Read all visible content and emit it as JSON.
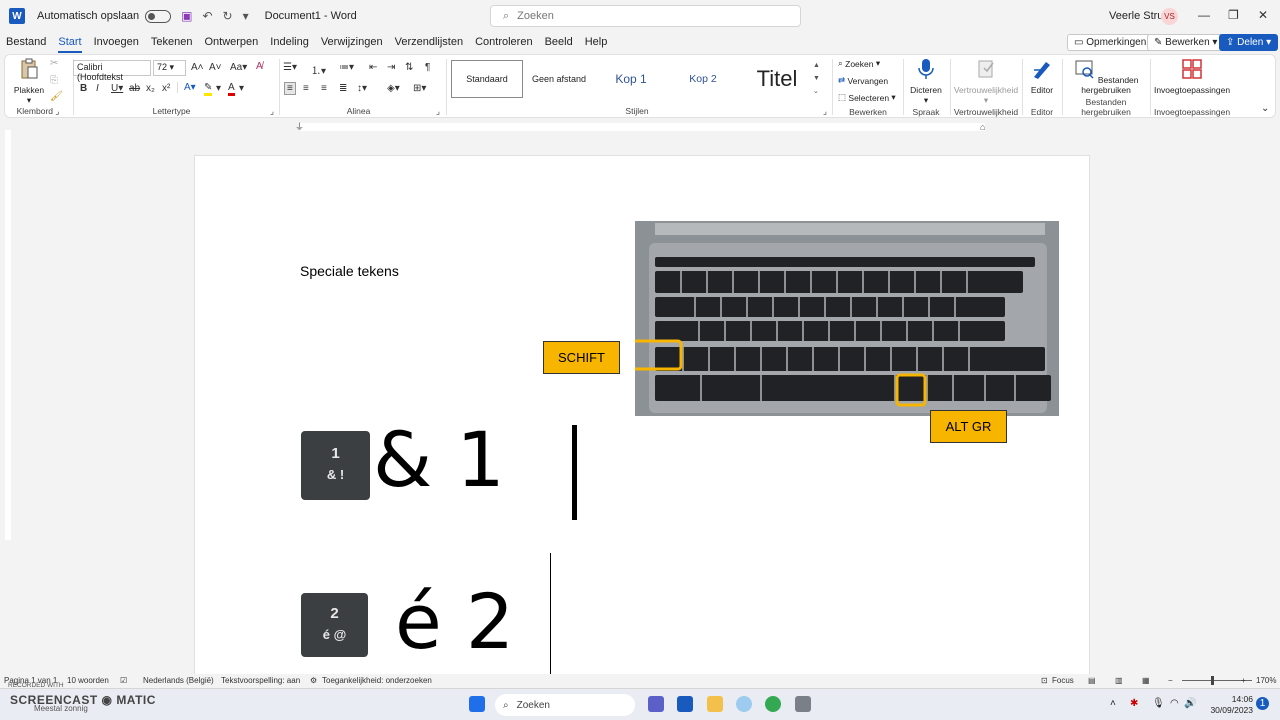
{
  "titlebar": {
    "autosave_label": "Automatisch opslaan",
    "doc_title": "Document1  -  Word",
    "search_placeholder": "Zoeken",
    "user_name": "Veerle Struye",
    "user_initials": "VS"
  },
  "menu": {
    "tabs": [
      "Bestand",
      "Start",
      "Invoegen",
      "Tekenen",
      "Ontwerpen",
      "Indeling",
      "Verwijzingen",
      "Verzendlijsten",
      "Controleren",
      "Beeld",
      "Help"
    ],
    "active": "Start",
    "comments_label": "Opmerkingen",
    "edit_label": "Bewerken",
    "share_label": "Delen"
  },
  "ribbon": {
    "clipboard": {
      "paste": "Plakken",
      "group": "Klembord"
    },
    "font": {
      "name": "Calibri (Hoofdtekst",
      "size": "72",
      "group": "Lettertype"
    },
    "paragraph": {
      "group": "Alinea"
    },
    "styles": {
      "items": [
        "Standaard",
        "Geen afstand",
        "Kop 1",
        "Kop 2",
        "Titel"
      ],
      "group": "Stijlen"
    },
    "editing": {
      "find": "Zoeken",
      "replace": "Vervangen",
      "select": "Selecteren",
      "group": "Bewerken"
    },
    "voice": {
      "dictate": "Dicteren",
      "group": "Spraak"
    },
    "sensitivity": {
      "label": "Vertrouwelijkheid",
      "group": "Vertrouwelijkheid"
    },
    "editor": {
      "label": "Editor",
      "group": "Editor"
    },
    "reuse": {
      "label": "Bestanden hergebruiken",
      "group": "Bestanden hergebruiken"
    },
    "addins": {
      "label": "Invoegtoepassingen",
      "group": "Invoegtoepassingen"
    }
  },
  "document": {
    "heading": "Speciale tekens",
    "callout_shift": "SCHIFT",
    "callout_altgr": "ALT GR",
    "line1_key_top": "1",
    "line1_key_bottom": "& !",
    "line1_text": "& 1",
    "line2_key_top": "2",
    "line2_key_bottom": "é @",
    "line2_text": "é 2"
  },
  "status": {
    "page": "Pagina 1 van 1",
    "words": "10 woorden",
    "language": "Nederlands (België)",
    "predictions": "Tekstvoorspelling: aan",
    "accessibility": "Toegankelijkheid: onderzoeken",
    "focus": "Focus",
    "zoom": "170%"
  },
  "taskbar": {
    "search": "Zoeken",
    "time": "14:06",
    "date": "30/09/2023",
    "watermark_top": "RECORDED WITH",
    "watermark_brand": "SCREENCAST ◉ MATIC",
    "weather": "Meestal zonnig"
  },
  "colors": {
    "accent": "#185abd",
    "callout": "#f7b500"
  }
}
